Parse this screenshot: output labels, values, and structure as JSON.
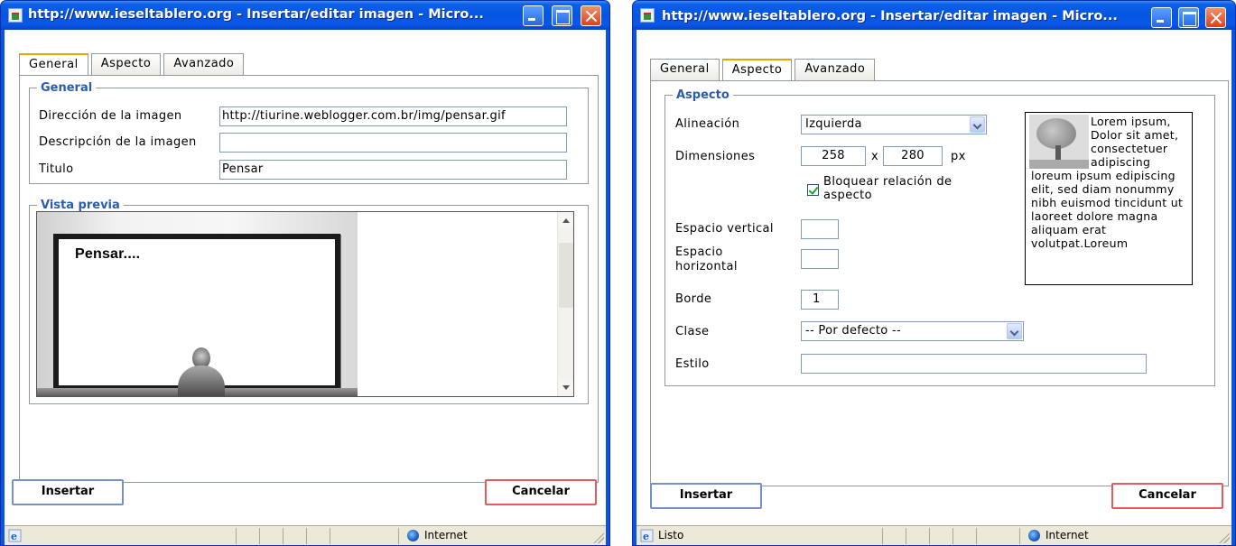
{
  "window1": {
    "title": "http://www.ieseltablero.org - Insertar/editar imagen - Micro...",
    "tabs": [
      "General",
      "Aspecto",
      "Avanzado"
    ],
    "general_legend": "General",
    "image_url_label": "Dirección de la imagen",
    "image_url_value": "http://tiurine.weblogger.com.br/img/pensar.gif",
    "description_label": "Descripción de la imagen",
    "description_value": "",
    "title_label": "Titulo",
    "title_value": "Pensar",
    "preview_legend": "Vista previa",
    "preview_text": "Pensar....",
    "insert_button": "Insertar",
    "cancel_button": "Cancelar",
    "status_text": "",
    "zone_text": "Internet"
  },
  "window2": {
    "title": "http://www.ieseltablero.org - Insertar/editar imagen - Micro...",
    "tabs": [
      "General",
      "Aspecto",
      "Avanzado"
    ],
    "aspect_legend": "Aspecto",
    "alignment_label": "Alineación",
    "alignment_value": "Izquierda",
    "dimensions_label": "Dimensiones",
    "width_value": "258",
    "height_value": "280",
    "dim_separator": "x",
    "unit": "px",
    "lock_ratio_label": "Bloquear relación de aspecto",
    "lock_ratio_checked": true,
    "vspace_label": "Espacio vertical",
    "vspace_value": "",
    "hspace_label": "Espacio horizontal",
    "hspace_value": "",
    "border_label": "Borde",
    "border_value": "1",
    "class_label": "Clase",
    "class_value": "-- Por defecto --",
    "style_label": "Estilo",
    "style_value": "",
    "sample_text": "Lorem ipsum, Dolor sit amet, consectetuer adipiscing loreum ipsum edipiscing elit, sed diam nonummy nibh euismod tincidunt ut laoreet dolore magna aliquam erat volutpat.Loreum",
    "insert_button": "Insertar",
    "cancel_button": "Cancelar",
    "status_text": "Listo",
    "zone_text": "Internet"
  },
  "colors": {
    "titlebar": "#0a5fe8",
    "legend": "#2a5db0",
    "active_tab_accent": "#e8a400",
    "insert_border": "#7591c6",
    "cancel_border": "#e45b5b"
  }
}
